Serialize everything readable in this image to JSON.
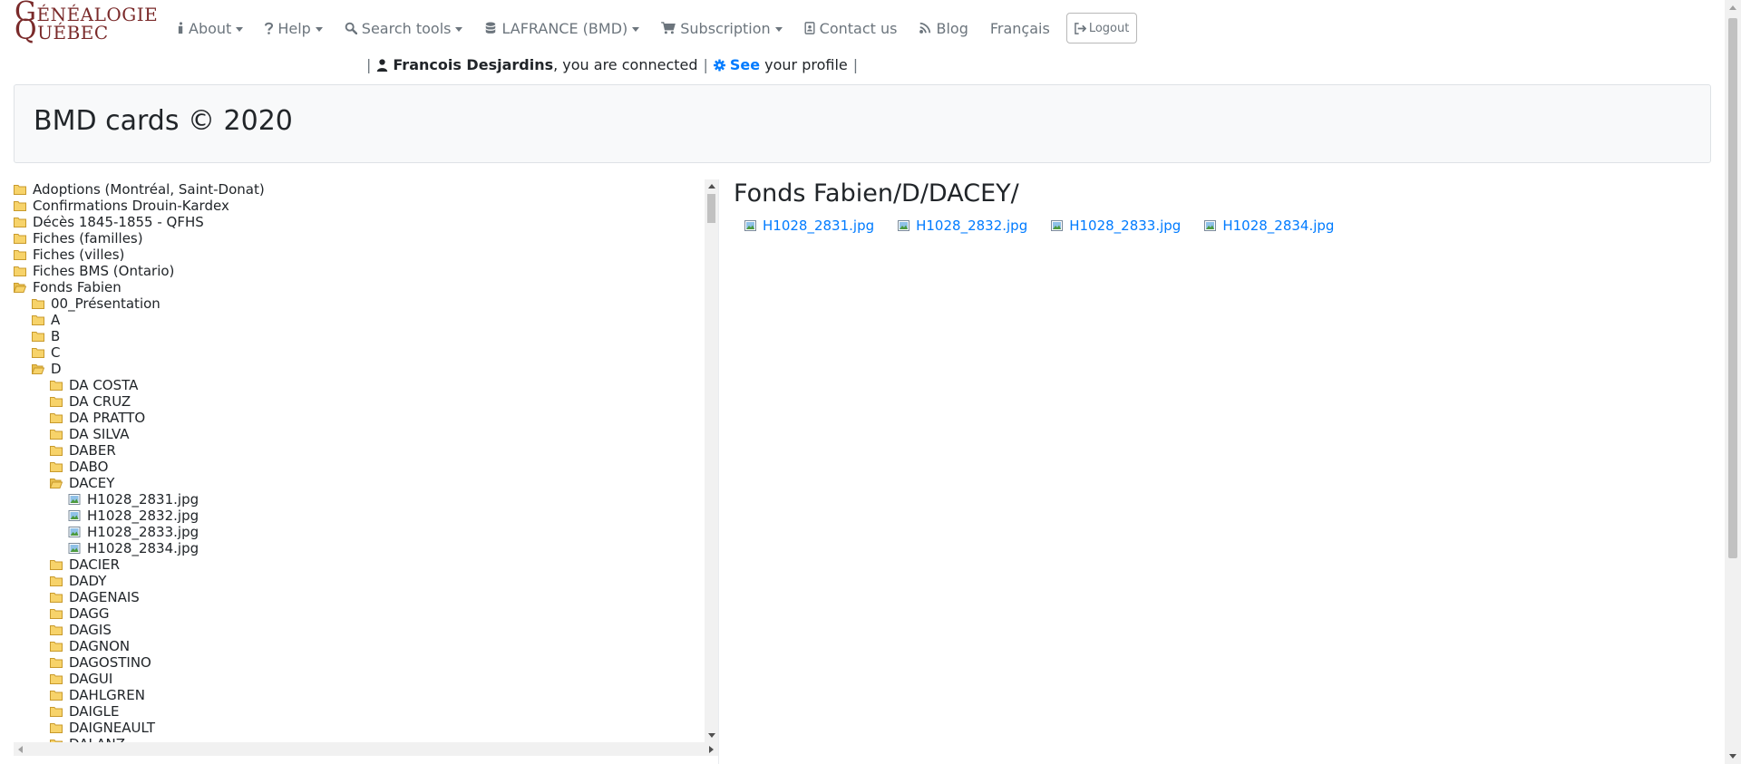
{
  "navbar": {
    "logo": {
      "line1_big": "G",
      "line1_rest": "ÉNÉALOGIE",
      "line2_big": "Q",
      "line2_rest": "UÉBEC",
      "color": "#7a2a2a"
    },
    "items": [
      {
        "label": "About",
        "icon": "info-icon",
        "dropdown": true
      },
      {
        "label": "Help",
        "icon": "question-icon",
        "dropdown": true
      },
      {
        "label": "Search tools",
        "icon": "search-icon",
        "dropdown": true
      },
      {
        "label": "LAFRANCE (BMD)",
        "icon": "database-icon",
        "dropdown": true
      },
      {
        "label": "Subscription",
        "icon": "cart-icon",
        "dropdown": true
      },
      {
        "label": "Contact us",
        "icon": "contact-card-icon",
        "dropdown": false
      },
      {
        "label": "Blog",
        "icon": "blog-icon",
        "dropdown": false
      },
      {
        "label": "Français",
        "icon": null,
        "dropdown": false
      }
    ],
    "logout_label": "Logout"
  },
  "connected": {
    "user_name": "Francois Desjardins",
    "connected_text": ", you are connected",
    "see_label": "See",
    "profile_text": "your profile",
    "separator": "|"
  },
  "header": {
    "title": "BMD cards © 2020"
  },
  "tree": [
    {
      "label": "Adoptions (Montréal, Saint-Donat)",
      "level": 0,
      "type": "folder"
    },
    {
      "label": "Confirmations Drouin-Kardex",
      "level": 0,
      "type": "folder"
    },
    {
      "label": "Décès 1845-1855 - QFHS",
      "level": 0,
      "type": "folder"
    },
    {
      "label": "Fiches (familles)",
      "level": 0,
      "type": "folder"
    },
    {
      "label": "Fiches (villes)",
      "level": 0,
      "type": "folder"
    },
    {
      "label": "Fiches BMS (Ontario)",
      "level": 0,
      "type": "folder"
    },
    {
      "label": "Fonds Fabien",
      "level": 0,
      "type": "folder-open"
    },
    {
      "label": "00_Présentation",
      "level": 1,
      "type": "folder"
    },
    {
      "label": "A",
      "level": 1,
      "type": "folder"
    },
    {
      "label": "B",
      "level": 1,
      "type": "folder"
    },
    {
      "label": "C",
      "level": 1,
      "type": "folder"
    },
    {
      "label": "D",
      "level": 1,
      "type": "folder-open"
    },
    {
      "label": "DA COSTA",
      "level": 2,
      "type": "folder"
    },
    {
      "label": "DA CRUZ",
      "level": 2,
      "type": "folder"
    },
    {
      "label": "DA PRATTO",
      "level": 2,
      "type": "folder"
    },
    {
      "label": "DA SILVA",
      "level": 2,
      "type": "folder"
    },
    {
      "label": "DABER",
      "level": 2,
      "type": "folder"
    },
    {
      "label": "DABO",
      "level": 2,
      "type": "folder"
    },
    {
      "label": "DACEY",
      "level": 2,
      "type": "folder-open"
    },
    {
      "label": "H1028_2831.jpg",
      "level": 3,
      "type": "image"
    },
    {
      "label": "H1028_2832.jpg",
      "level": 3,
      "type": "image"
    },
    {
      "label": "H1028_2833.jpg",
      "level": 3,
      "type": "image"
    },
    {
      "label": "H1028_2834.jpg",
      "level": 3,
      "type": "image"
    },
    {
      "label": "DACIER",
      "level": 2,
      "type": "folder"
    },
    {
      "label": "DADY",
      "level": 2,
      "type": "folder"
    },
    {
      "label": "DAGENAIS",
      "level": 2,
      "type": "folder"
    },
    {
      "label": "DAGG",
      "level": 2,
      "type": "folder"
    },
    {
      "label": "DAGIS",
      "level": 2,
      "type": "folder"
    },
    {
      "label": "DAGNON",
      "level": 2,
      "type": "folder"
    },
    {
      "label": "DAGOSTINO",
      "level": 2,
      "type": "folder"
    },
    {
      "label": "DAGUI",
      "level": 2,
      "type": "folder"
    },
    {
      "label": "DAHLGREN",
      "level": 2,
      "type": "folder"
    },
    {
      "label": "DAIGLE",
      "level": 2,
      "type": "folder"
    },
    {
      "label": "DAIGNEAULT",
      "level": 2,
      "type": "folder"
    },
    {
      "label": "DALANZ",
      "level": 2,
      "type": "folder"
    }
  ],
  "content": {
    "path_title": "Fonds Fabien/D/DACEY/",
    "files": [
      "H1028_2831.jpg",
      "H1028_2832.jpg",
      "H1028_2833.jpg",
      "H1028_2834.jpg"
    ]
  },
  "colors": {
    "link": "#007bff",
    "nav_text": "#6c757d",
    "folder": "#e8b84a",
    "jumbotron_bg": "#f8f9fa"
  }
}
